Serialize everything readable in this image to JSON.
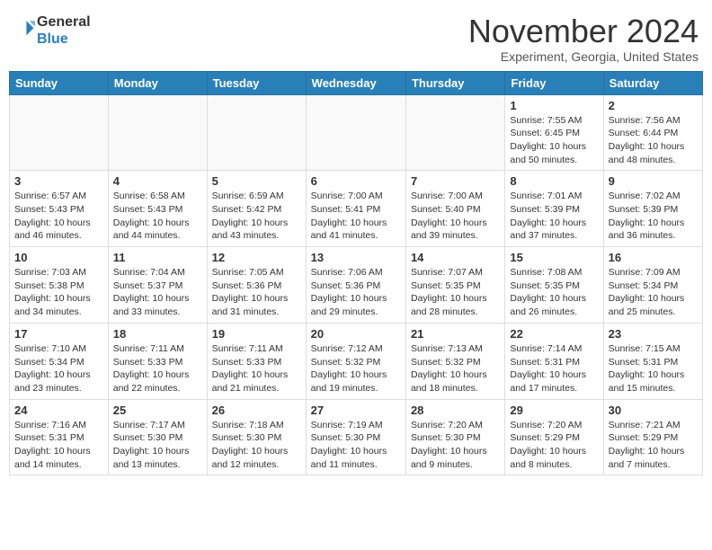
{
  "header": {
    "logo_line1": "General",
    "logo_line2": "Blue",
    "month": "November 2024",
    "location": "Experiment, Georgia, United States"
  },
  "weekdays": [
    "Sunday",
    "Monday",
    "Tuesday",
    "Wednesday",
    "Thursday",
    "Friday",
    "Saturday"
  ],
  "weeks": [
    [
      {
        "day": "",
        "info": ""
      },
      {
        "day": "",
        "info": ""
      },
      {
        "day": "",
        "info": ""
      },
      {
        "day": "",
        "info": ""
      },
      {
        "day": "",
        "info": ""
      },
      {
        "day": "1",
        "info": "Sunrise: 7:55 AM\nSunset: 6:45 PM\nDaylight: 10 hours and 50 minutes."
      },
      {
        "day": "2",
        "info": "Sunrise: 7:56 AM\nSunset: 6:44 PM\nDaylight: 10 hours and 48 minutes."
      }
    ],
    [
      {
        "day": "3",
        "info": "Sunrise: 6:57 AM\nSunset: 5:43 PM\nDaylight: 10 hours and 46 minutes."
      },
      {
        "day": "4",
        "info": "Sunrise: 6:58 AM\nSunset: 5:43 PM\nDaylight: 10 hours and 44 minutes."
      },
      {
        "day": "5",
        "info": "Sunrise: 6:59 AM\nSunset: 5:42 PM\nDaylight: 10 hours and 43 minutes."
      },
      {
        "day": "6",
        "info": "Sunrise: 7:00 AM\nSunset: 5:41 PM\nDaylight: 10 hours and 41 minutes."
      },
      {
        "day": "7",
        "info": "Sunrise: 7:00 AM\nSunset: 5:40 PM\nDaylight: 10 hours and 39 minutes."
      },
      {
        "day": "8",
        "info": "Sunrise: 7:01 AM\nSunset: 5:39 PM\nDaylight: 10 hours and 37 minutes."
      },
      {
        "day": "9",
        "info": "Sunrise: 7:02 AM\nSunset: 5:39 PM\nDaylight: 10 hours and 36 minutes."
      }
    ],
    [
      {
        "day": "10",
        "info": "Sunrise: 7:03 AM\nSunset: 5:38 PM\nDaylight: 10 hours and 34 minutes."
      },
      {
        "day": "11",
        "info": "Sunrise: 7:04 AM\nSunset: 5:37 PM\nDaylight: 10 hours and 33 minutes."
      },
      {
        "day": "12",
        "info": "Sunrise: 7:05 AM\nSunset: 5:36 PM\nDaylight: 10 hours and 31 minutes."
      },
      {
        "day": "13",
        "info": "Sunrise: 7:06 AM\nSunset: 5:36 PM\nDaylight: 10 hours and 29 minutes."
      },
      {
        "day": "14",
        "info": "Sunrise: 7:07 AM\nSunset: 5:35 PM\nDaylight: 10 hours and 28 minutes."
      },
      {
        "day": "15",
        "info": "Sunrise: 7:08 AM\nSunset: 5:35 PM\nDaylight: 10 hours and 26 minutes."
      },
      {
        "day": "16",
        "info": "Sunrise: 7:09 AM\nSunset: 5:34 PM\nDaylight: 10 hours and 25 minutes."
      }
    ],
    [
      {
        "day": "17",
        "info": "Sunrise: 7:10 AM\nSunset: 5:34 PM\nDaylight: 10 hours and 23 minutes."
      },
      {
        "day": "18",
        "info": "Sunrise: 7:11 AM\nSunset: 5:33 PM\nDaylight: 10 hours and 22 minutes."
      },
      {
        "day": "19",
        "info": "Sunrise: 7:11 AM\nSunset: 5:33 PM\nDaylight: 10 hours and 21 minutes."
      },
      {
        "day": "20",
        "info": "Sunrise: 7:12 AM\nSunset: 5:32 PM\nDaylight: 10 hours and 19 minutes."
      },
      {
        "day": "21",
        "info": "Sunrise: 7:13 AM\nSunset: 5:32 PM\nDaylight: 10 hours and 18 minutes."
      },
      {
        "day": "22",
        "info": "Sunrise: 7:14 AM\nSunset: 5:31 PM\nDaylight: 10 hours and 17 minutes."
      },
      {
        "day": "23",
        "info": "Sunrise: 7:15 AM\nSunset: 5:31 PM\nDaylight: 10 hours and 15 minutes."
      }
    ],
    [
      {
        "day": "24",
        "info": "Sunrise: 7:16 AM\nSunset: 5:31 PM\nDaylight: 10 hours and 14 minutes."
      },
      {
        "day": "25",
        "info": "Sunrise: 7:17 AM\nSunset: 5:30 PM\nDaylight: 10 hours and 13 minutes."
      },
      {
        "day": "26",
        "info": "Sunrise: 7:18 AM\nSunset: 5:30 PM\nDaylight: 10 hours and 12 minutes."
      },
      {
        "day": "27",
        "info": "Sunrise: 7:19 AM\nSunset: 5:30 PM\nDaylight: 10 hours and 11 minutes."
      },
      {
        "day": "28",
        "info": "Sunrise: 7:20 AM\nSunset: 5:30 PM\nDaylight: 10 hours and 9 minutes."
      },
      {
        "day": "29",
        "info": "Sunrise: 7:20 AM\nSunset: 5:29 PM\nDaylight: 10 hours and 8 minutes."
      },
      {
        "day": "30",
        "info": "Sunrise: 7:21 AM\nSunset: 5:29 PM\nDaylight: 10 hours and 7 minutes."
      }
    ]
  ]
}
